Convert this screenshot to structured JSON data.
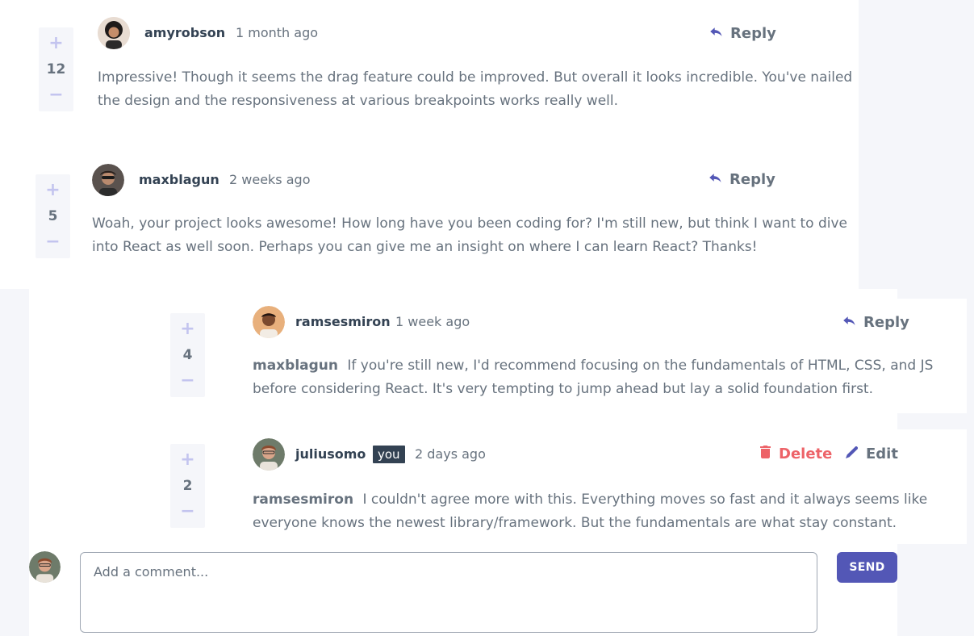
{
  "comments": [
    {
      "username": "amyrobson",
      "date": "1 month ago",
      "score": "12",
      "content": "Impressive! Though it seems the drag feature could be improved. But overall it looks incredible. You've nailed the design and the responsiveness at various breakpoints works really well.",
      "reply_label": "Reply"
    },
    {
      "username": "maxblagun",
      "date": "2 weeks ago",
      "score": "5",
      "content": "Woah, your project looks awesome! How long have you been coding for? I'm still new, but think I want to dive into React as well soon. Perhaps you can give me an insight on where I can learn React? Thanks!",
      "reply_label": "Reply"
    }
  ],
  "replies": [
    {
      "username": "ramsesmiron",
      "date": "1 week ago",
      "score": "4",
      "replying_to": "maxblagun",
      "content": "If you're still new, I'd recommend focusing on the fundamentals of HTML, CSS, and JS before considering React. It's very tempting to jump ahead but lay a solid foundation first.",
      "reply_label": "Reply"
    },
    {
      "username": "juliusomo",
      "you_badge": "you",
      "date": "2 days ago",
      "score": "2",
      "replying_to": "ramsesmiron",
      "content": "I couldn't agree more with this. Everything moves so fast and it always seems like everyone knows the newest library/framework. But the fundamentals are what stay constant.",
      "delete_label": "Delete",
      "edit_label": "Edit"
    }
  ],
  "vote": {
    "plus": "+",
    "minus": "−"
  },
  "compose": {
    "placeholder": "Add a comment...",
    "send_label": "SEND"
  },
  "colors": {
    "primary": "#5357b6",
    "danger": "#ed6368",
    "text": "#67727e",
    "heading": "#334253",
    "vote_bg": "#f5f6fa",
    "vote_sign": "#c3c4ef"
  }
}
